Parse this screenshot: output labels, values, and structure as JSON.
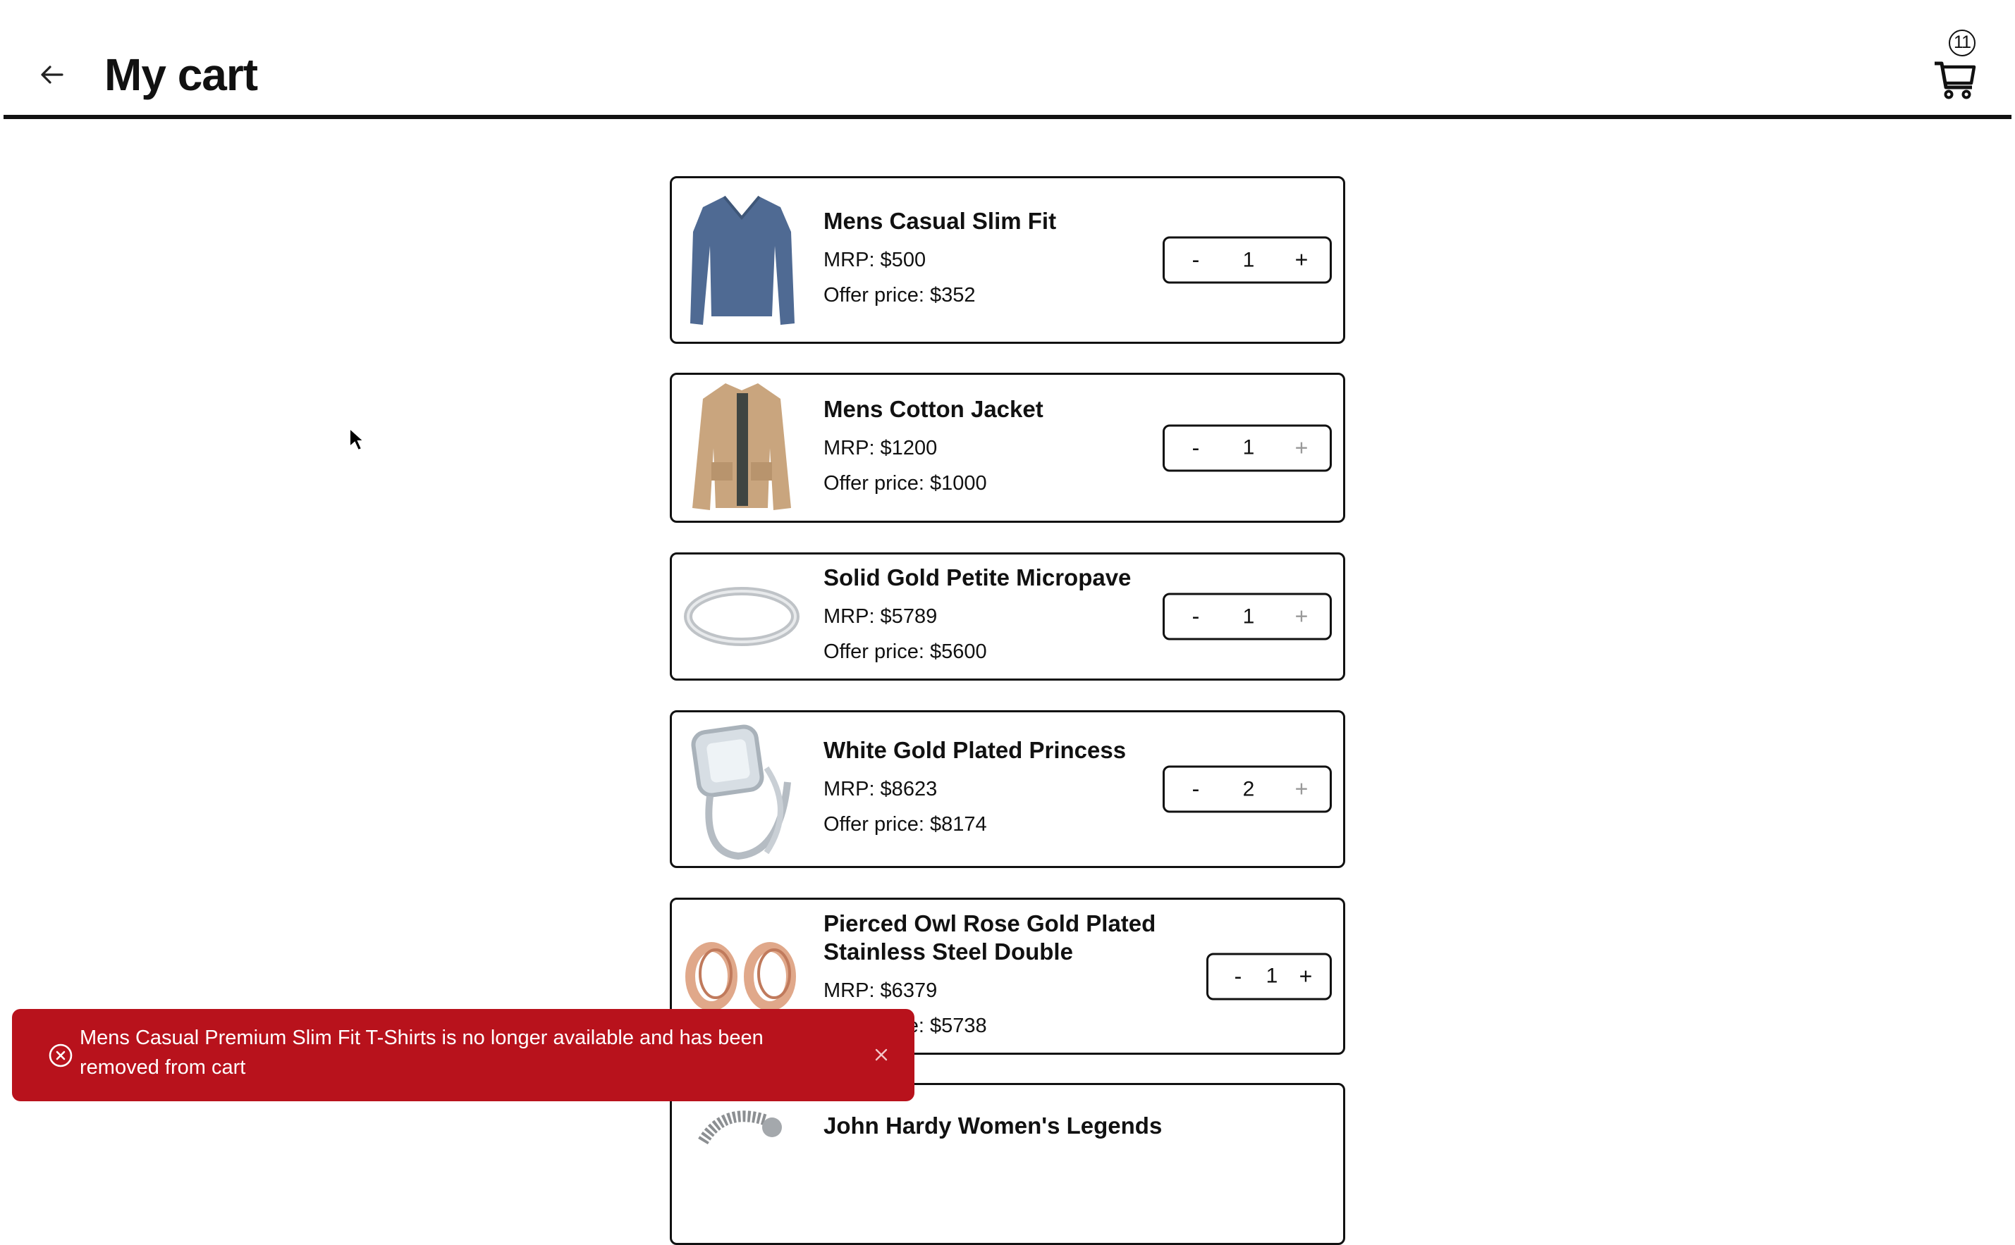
{
  "header": {
    "title": "My cart",
    "back_icon": "arrow-left-icon",
    "cart_icon": "shopping-cart-icon",
    "cart_count": "11"
  },
  "items": [
    {
      "name": "Mens Casual Slim Fit",
      "mrp": "MRP: $500",
      "offer": "Offer price: $352",
      "quantity": "1",
      "minus_label": "-",
      "plus_label": "+",
      "plus_disabled": false,
      "image": "blue-long-sleeve-tshirt"
    },
    {
      "name": "Mens Cotton Jacket",
      "mrp": "MRP: $1200",
      "offer": "Offer price: $1000",
      "quantity": "1",
      "minus_label": "-",
      "plus_label": "+",
      "plus_disabled": true,
      "image": "khaki-cotton-jacket"
    },
    {
      "name": "Solid Gold Petite Micropave",
      "mrp": "MRP: $5789",
      "offer": "Offer price: $5600",
      "quantity": "1",
      "minus_label": "-",
      "plus_label": "+",
      "plus_disabled": true,
      "image": "silver-band-ring"
    },
    {
      "name": "White Gold Plated Princess",
      "mrp": "MRP: $8623",
      "offer": "Offer price: $8174",
      "quantity": "2",
      "minus_label": "-",
      "plus_label": "+",
      "plus_disabled": true,
      "image": "princess-diamond-ring-set"
    },
    {
      "name": "Pierced Owl Rose Gold Plated Stainless Steel Double",
      "mrp": "MRP: $6379",
      "offer": "Offer price: $5738",
      "quantity": "1",
      "minus_label": "-",
      "plus_label": "+",
      "plus_disabled": false,
      "image": "rose-gold-tunnel-plugs"
    },
    {
      "name": "John Hardy Women's Legends",
      "image": "dragon-chain-bracelet"
    }
  ],
  "toast": {
    "type": "error",
    "icon": "x-circle-icon",
    "message": "Mens Casual Premium Slim Fit T-Shirts is no longer available and has been removed from cart",
    "close_icon": "close-icon",
    "color": "#B8121C"
  }
}
